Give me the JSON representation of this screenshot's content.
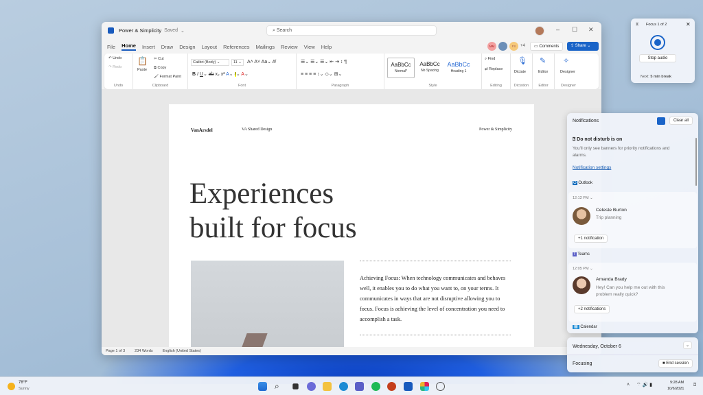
{
  "word": {
    "doc_title": "Power & Simplicity",
    "saved_status": "Saved",
    "search_placeholder": "Search",
    "tabs": [
      "File",
      "Home",
      "Insert",
      "Draw",
      "Design",
      "Layout",
      "References",
      "Mailings",
      "Review",
      "View",
      "Help"
    ],
    "active_tab": "Home",
    "collaborators": [
      "MM",
      "FS"
    ],
    "collaborators_more": "+4",
    "comments_label": "Comments",
    "share_label": "Share",
    "ribbon": {
      "undo": "Undo",
      "redo": "Redo",
      "undo_group": "Undo",
      "paste": "Paste",
      "cut": "Cut",
      "copy": "Copy",
      "format_paint": "Format Paint",
      "clipboard_group": "Clipboard",
      "font_name": "Calibri (Body)",
      "font_size": "11",
      "font_group": "Font",
      "paragraph_group": "Paragraph",
      "styles": [
        {
          "sample": "AaBbCc",
          "name": "Normal*"
        },
        {
          "sample": "AaBbCc",
          "name": "No Spacing"
        },
        {
          "sample": "AaBbCc",
          "name": "Heading 1"
        }
      ],
      "style_group": "Style",
      "find": "Find",
      "replace": "Replace",
      "editing_group": "Editing",
      "dictate": "Dictate",
      "dictation_group": "Dictation",
      "editor": "Editor",
      "editor_group": "Editor",
      "designer": "Designer",
      "designer_group": "Designer"
    },
    "page": {
      "brand": "VanArsdel",
      "header_center": "VA Shared Design",
      "header_right": "Power & Simplicity",
      "headline_1": "Experiences",
      "headline_2": "built for focus",
      "body": "Achieving Focus: When technology communicates and behaves well, it enables you to do what you want to, on your terms. It communicates in ways that are not disruptive allowing you to focus. Focus is achieving the level of concentration you need to accomplish a task."
    },
    "status_bar": {
      "page": "Page 1 of 3",
      "words": "234 Words",
      "language": "English (United States)"
    }
  },
  "focus_widget": {
    "title": "Focus 1 of 2",
    "stop_audio": "Stop audio",
    "next_prefix": "Next:",
    "next_value": "5 min break"
  },
  "notifications": {
    "title": "Notifications",
    "clear_all": "Clear all",
    "dnd_title": "Do not disturb is on",
    "dnd_text": "You'll only see banners for priority notifications and alarms.",
    "settings_link": "Notification settings",
    "groups": [
      {
        "app": "Outlook",
        "time": "12:12 PM",
        "sender": "Celeste Burton",
        "message": "Trip planning",
        "more": "+1 notification"
      },
      {
        "app": "Teams",
        "time": "12:05 PM",
        "sender": "Amanda Brady",
        "message": "Hey! Can you help me out with this problem really quick?",
        "more": "+2 notifications"
      },
      {
        "app": "Calendar"
      }
    ]
  },
  "calendar": {
    "date": "Wednesday, October 6",
    "focusing": "Focusing",
    "end_session": "End session"
  },
  "taskbar": {
    "weather_temp": "78°F",
    "weather_cond": "Sunny",
    "time": "9:28 AM",
    "date": "10/6/2021",
    "apps": [
      "start",
      "search",
      "task-view",
      "chat",
      "file-explorer",
      "edge",
      "teams",
      "spotify",
      "powerpoint",
      "word",
      "slack",
      "clock"
    ]
  },
  "colors": {
    "accent": "#185abd",
    "share": "#1a64c8",
    "link": "#1a5fb4"
  }
}
